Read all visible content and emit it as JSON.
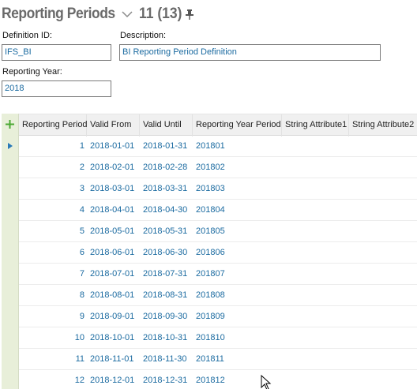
{
  "header": {
    "title": "Reporting Periods",
    "count": "11 (13)"
  },
  "form": {
    "definition_id_label": "Definition ID:",
    "definition_id_value": "IFS_BI",
    "description_label": "Description:",
    "description_value": "BI Reporting Period Definition",
    "reporting_year_label": "Reporting Year:",
    "reporting_year_value": "2018"
  },
  "table": {
    "columns": [
      "Reporting Period",
      "Valid From",
      "Valid Until",
      "Reporting Year Period",
      "String Attribute1",
      "String Attribute2"
    ],
    "rows": [
      {
        "period": "1",
        "from": "2018-01-01",
        "until": "2018-01-31",
        "year_period": "201801"
      },
      {
        "period": "2",
        "from": "2018-02-01",
        "until": "2018-02-28",
        "year_period": "201802"
      },
      {
        "period": "3",
        "from": "2018-03-01",
        "until": "2018-03-31",
        "year_period": "201803"
      },
      {
        "period": "4",
        "from": "2018-04-01",
        "until": "2018-04-30",
        "year_period": "201804"
      },
      {
        "period": "5",
        "from": "2018-05-01",
        "until": "2018-05-31",
        "year_period": "201805"
      },
      {
        "period": "6",
        "from": "2018-06-01",
        "until": "2018-06-30",
        "year_period": "201806"
      },
      {
        "period": "7",
        "from": "2018-07-01",
        "until": "2018-07-31",
        "year_period": "201807"
      },
      {
        "period": "8",
        "from": "2018-08-01",
        "until": "2018-08-31",
        "year_period": "201808"
      },
      {
        "period": "9",
        "from": "2018-09-01",
        "until": "2018-09-30",
        "year_period": "201809"
      },
      {
        "period": "10",
        "from": "2018-10-01",
        "until": "2018-10-31",
        "year_period": "201810"
      },
      {
        "period": "11",
        "from": "2018-11-01",
        "until": "2018-11-30",
        "year_period": "201811"
      },
      {
        "period": "12",
        "from": "2018-12-01",
        "until": "2018-12-31",
        "year_period": "201812"
      }
    ],
    "selected_row": 0
  },
  "icons": {
    "chevron": "chevron-down-icon",
    "pin": "pin-icon",
    "add": "plus-icon",
    "row_marker": "play-arrow-icon",
    "cursor": "mouse-pointer-icon"
  },
  "colors": {
    "title": "#6a6a6a",
    "value_text": "#1a6aa0",
    "add_column": "#e8efd9",
    "add_icon": "#4aa832",
    "row_marker": "#2a7ab8"
  }
}
